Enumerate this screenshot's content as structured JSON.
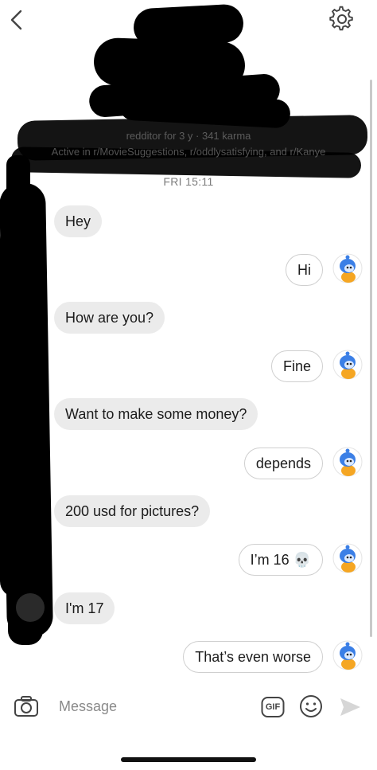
{
  "profile": {
    "karma_line": "redditor for 3 y · 341 karma",
    "active_line": "Active in r/MovieSuggestions, r/oddlysatisfying, and r/Kanye"
  },
  "thread": {
    "timestamp": "FRI 15:11",
    "messages": [
      {
        "side": "in",
        "text": "Hey"
      },
      {
        "side": "out",
        "text": "Hi"
      },
      {
        "side": "in",
        "text": "How are you?"
      },
      {
        "side": "out",
        "text": "Fine"
      },
      {
        "side": "in",
        "text": "Want to make some money?"
      },
      {
        "side": "out",
        "text": "depends"
      },
      {
        "side": "in",
        "text": "200 usd for pictures?"
      },
      {
        "side": "out",
        "text": "I’m 16 💀"
      },
      {
        "side": "in",
        "text": "I'm 17"
      },
      {
        "side": "out",
        "text": "That’s even worse"
      }
    ]
  },
  "composer": {
    "placeholder": "Message",
    "gif_label": "GIF"
  },
  "icons": {
    "back": "chevron-left-icon",
    "settings": "gear-icon",
    "camera": "camera-icon",
    "emoji": "smiley-icon",
    "send": "send-icon"
  }
}
